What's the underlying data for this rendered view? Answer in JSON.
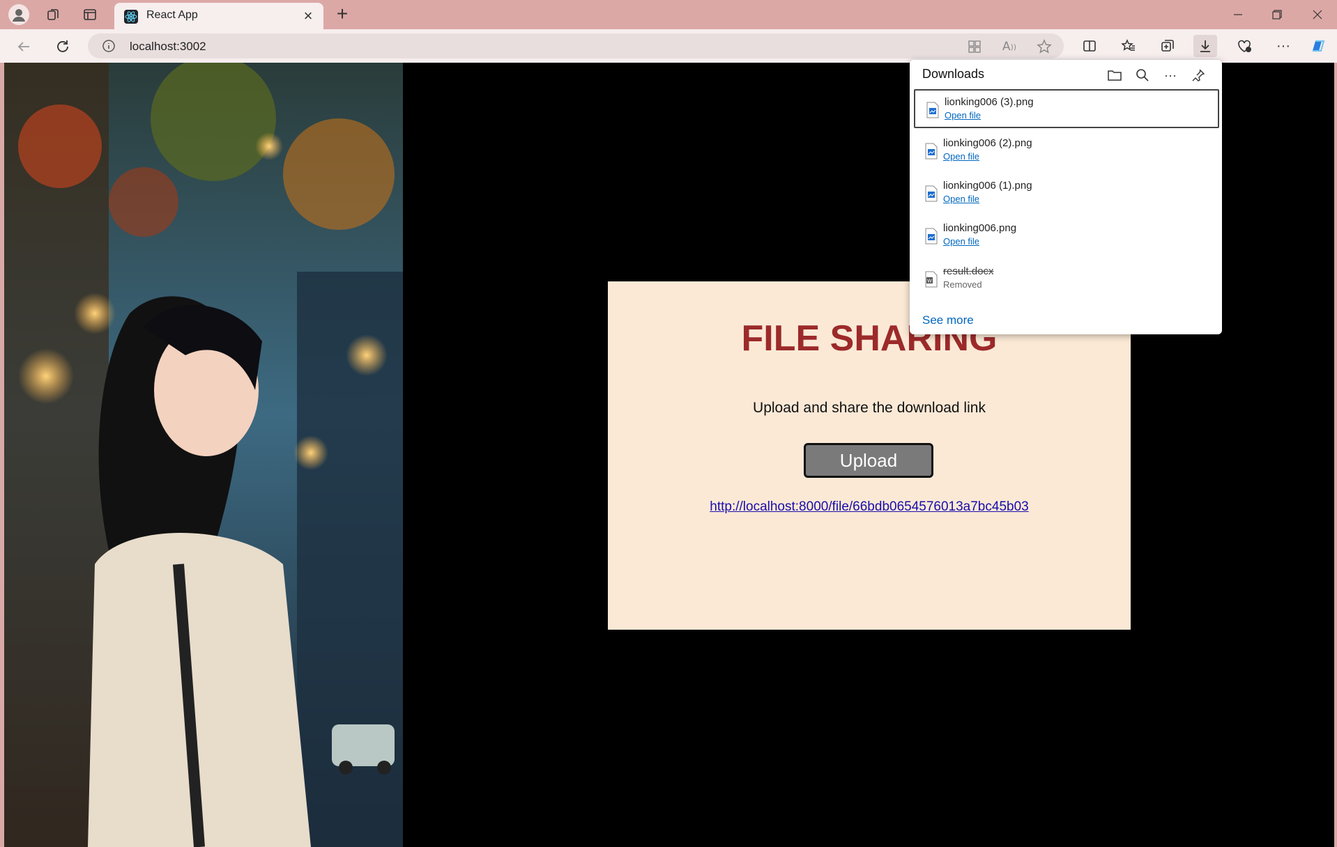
{
  "browser": {
    "tab": {
      "title": "React App",
      "favicon": "react-icon"
    },
    "address_bar": {
      "url": "localhost:3002"
    },
    "accent_color": "#dba8a6"
  },
  "page": {
    "title": "FILE SHARING",
    "subtitle": "Upload and share the download link",
    "upload_label": "Upload",
    "link": "http://localhost:8000/file/66bdb0654576013a7bc45b03",
    "card_bg": "#fbe9d6",
    "title_color": "#9c2a2a"
  },
  "downloads": {
    "title": "Downloads",
    "items": [
      {
        "name": "lionking006 (3).png",
        "action": "Open file",
        "state": "done",
        "selected": true
      },
      {
        "name": "lionking006 (2).png",
        "action": "Open file",
        "state": "done"
      },
      {
        "name": "lionking006 (1).png",
        "action": "Open file",
        "state": "done"
      },
      {
        "name": "lionking006.png",
        "action": "Open file",
        "state": "done"
      },
      {
        "name": "result.docx",
        "action": "Removed",
        "state": "removed"
      }
    ],
    "see_more": "See more"
  }
}
